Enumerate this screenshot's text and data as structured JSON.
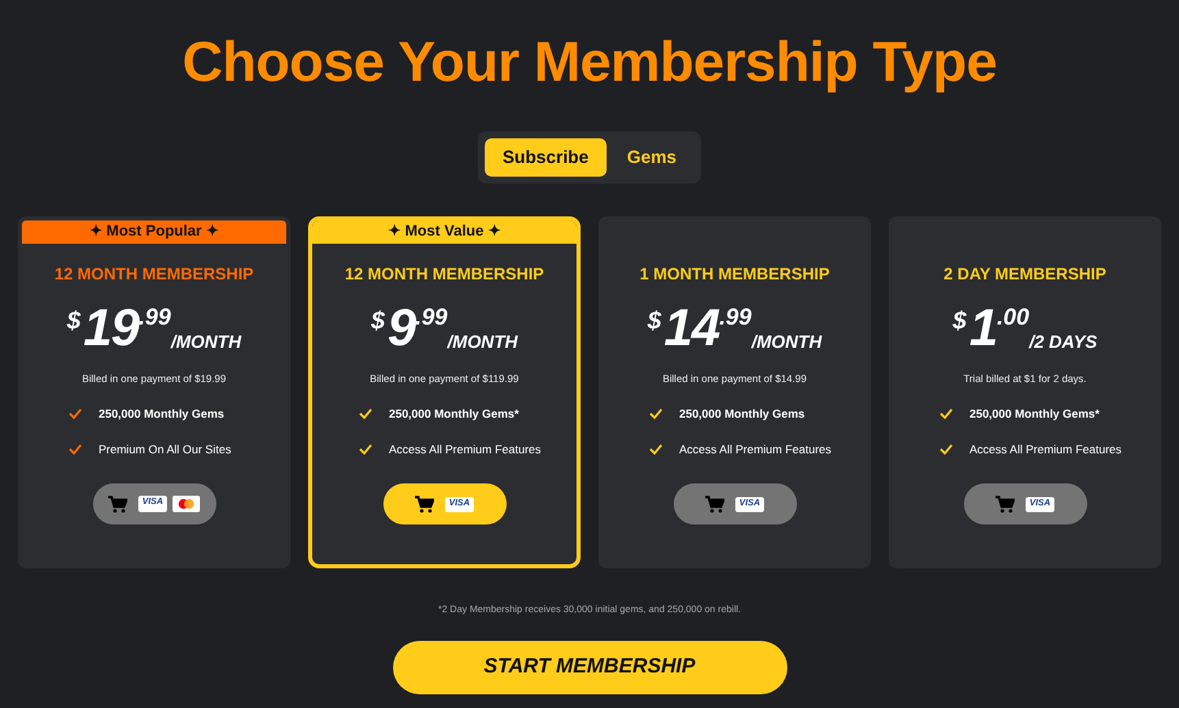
{
  "title": "Choose Your Membership Type",
  "tabs": [
    {
      "label": "Subscribe",
      "selected": true
    },
    {
      "label": "Gems",
      "selected": false
    }
  ],
  "plans": [
    {
      "ribbon": "✦ Most Popular ✦",
      "color": "#ff6a00",
      "name": "12 MONTH MEMBERSHIP",
      "currency": "$",
      "whole": "19",
      "cents": ".99",
      "period": "/MONTH",
      "billing": "Billed in one payment of $19.99",
      "features": [
        "250,000 Monthly Gems",
        "Premium On All Our Sites"
      ],
      "payments": [
        {
          "kind": "visa",
          "label": "VISA"
        },
        {
          "kind": "mastercard"
        }
      ],
      "selected": false
    },
    {
      "ribbon": "✦ Most Value ✦",
      "color": "#ffcc1a",
      "name": "12 MONTH MEMBERSHIP",
      "currency": "$",
      "whole": "9",
      "cents": ".99",
      "period": "/MONTH",
      "billing": "Billed in one payment of $119.99",
      "features": [
        "250,000 Monthly Gems*",
        "Access All Premium Features"
      ],
      "payments": [
        {
          "kind": "visa",
          "label": "VISA"
        }
      ],
      "selected": true
    },
    {
      "color": "#ffcc1a",
      "name": "1 MONTH MEMBERSHIP",
      "currency": "$",
      "whole": "14",
      "cents": ".99",
      "period": "/MONTH",
      "billing": "Billed in one payment of $14.99",
      "features": [
        "250,000 Monthly Gems",
        "Access All Premium Features"
      ],
      "payments": [
        {
          "kind": "visa",
          "label": "VISA"
        }
      ],
      "selected": false
    },
    {
      "color": "#ffcc1a",
      "name": "2 DAY MEMBERSHIP",
      "currency": "$",
      "whole": "1",
      "cents": ".00",
      "period": "/2 DAYS",
      "billing": "Trial billed at $1 for 2 days.",
      "features": [
        "250,000 Monthly Gems*",
        "Access All Premium Features"
      ],
      "payments": [
        {
          "kind": "visa",
          "label": "VISA"
        }
      ],
      "selected": false
    }
  ],
  "footnote": "*2 Day Membership receives 30,000 initial gems, and 250,000 on rebill.",
  "cta": "START MEMBERSHIP"
}
